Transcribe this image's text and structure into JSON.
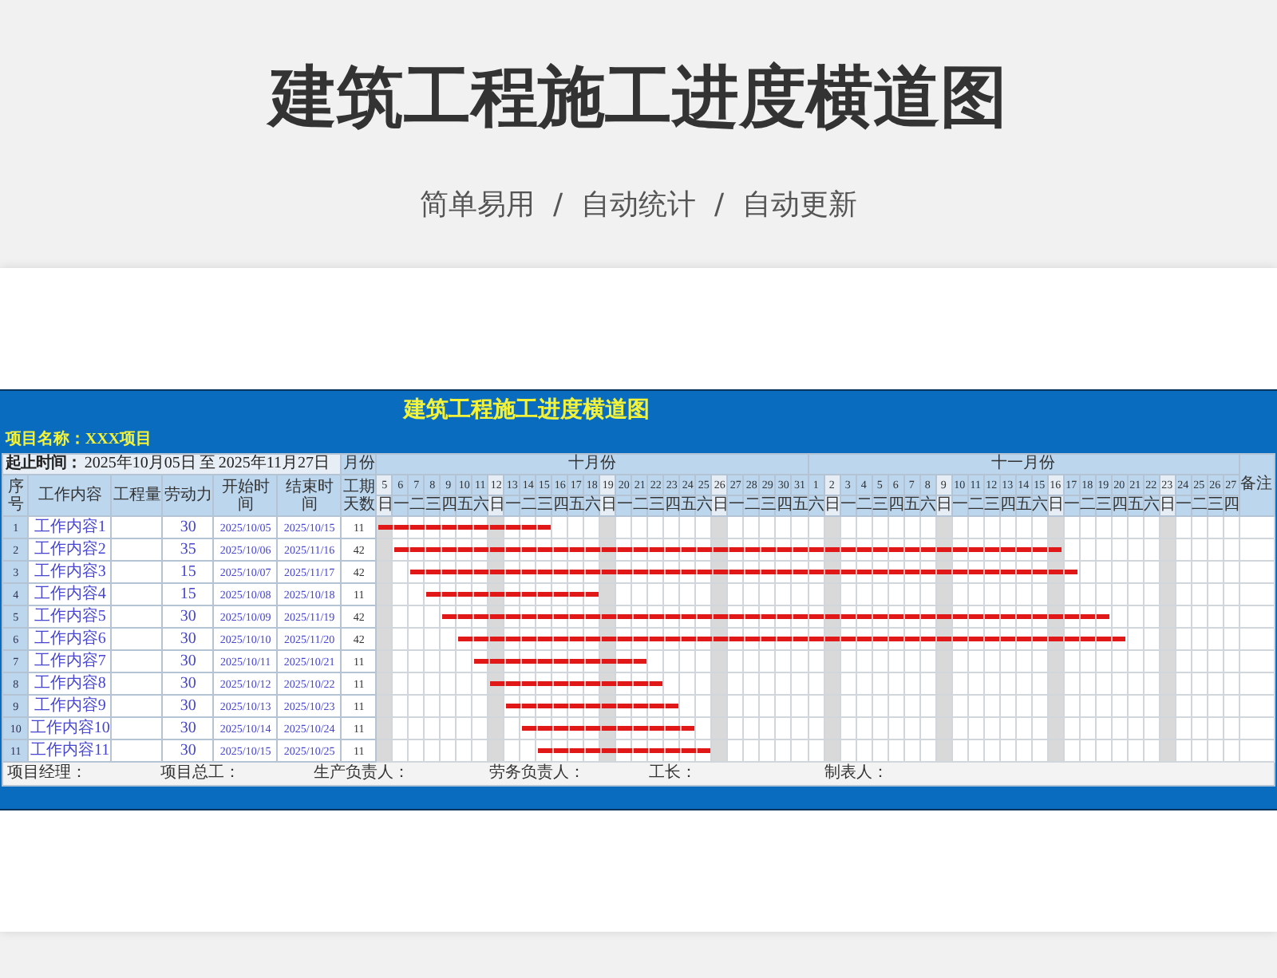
{
  "title": "建筑工程施工进度横道图",
  "subtitle": "简单易用  /  自动统计  /  自动更新",
  "sheet": {
    "title": "建筑工程施工进度横道图",
    "project": "项目名称：XXX项目",
    "date_range": {
      "label": "起止时间：",
      "start": "2025年10月05日",
      "to": "至",
      "end": "2025年11月27日"
    },
    "month_label": "月份",
    "remark_label": "备注",
    "columns": [
      "序号",
      "工作内容",
      "工程量",
      "劳动力",
      "开始时间",
      "结束时间",
      "工期天数"
    ],
    "months": [
      {
        "label": "十月份",
        "days": [
          {
            "day": "5",
            "weekday": "日",
            "weekend": true
          },
          {
            "day": "6",
            "weekday": "一",
            "weekend": false
          },
          {
            "day": "7",
            "weekday": "二",
            "weekend": false
          },
          {
            "day": "8",
            "weekday": "三",
            "weekend": false
          },
          {
            "day": "9",
            "weekday": "四",
            "weekend": false
          },
          {
            "day": "10",
            "weekday": "五",
            "weekend": false
          },
          {
            "day": "11",
            "weekday": "六",
            "weekend": false
          },
          {
            "day": "12",
            "weekday": "日",
            "weekend": true
          },
          {
            "day": "13",
            "weekday": "一",
            "weekend": false
          },
          {
            "day": "14",
            "weekday": "二",
            "weekend": false
          },
          {
            "day": "15",
            "weekday": "三",
            "weekend": false
          },
          {
            "day": "16",
            "weekday": "四",
            "weekend": false
          },
          {
            "day": "17",
            "weekday": "五",
            "weekend": false
          },
          {
            "day": "18",
            "weekday": "六",
            "weekend": false
          },
          {
            "day": "19",
            "weekday": "日",
            "weekend": true
          },
          {
            "day": "20",
            "weekday": "一",
            "weekend": false
          },
          {
            "day": "21",
            "weekday": "二",
            "weekend": false
          },
          {
            "day": "22",
            "weekday": "三",
            "weekend": false
          },
          {
            "day": "23",
            "weekday": "四",
            "weekend": false
          },
          {
            "day": "24",
            "weekday": "五",
            "weekend": false
          },
          {
            "day": "25",
            "weekday": "六",
            "weekend": false
          },
          {
            "day": "26",
            "weekday": "日",
            "weekend": true
          },
          {
            "day": "27",
            "weekday": "一",
            "weekend": false
          },
          {
            "day": "28",
            "weekday": "二",
            "weekend": false
          },
          {
            "day": "29",
            "weekday": "三",
            "weekend": false
          },
          {
            "day": "30",
            "weekday": "四",
            "weekend": false
          },
          {
            "day": "31",
            "weekday": "五",
            "weekend": false
          }
        ]
      },
      {
        "label": "十一月份",
        "days": [
          {
            "day": "1",
            "weekday": "六",
            "weekend": false
          },
          {
            "day": "2",
            "weekday": "日",
            "weekend": true
          },
          {
            "day": "3",
            "weekday": "一",
            "weekend": false
          },
          {
            "day": "4",
            "weekday": "二",
            "weekend": false
          },
          {
            "day": "5",
            "weekday": "三",
            "weekend": false
          },
          {
            "day": "6",
            "weekday": "四",
            "weekend": false
          },
          {
            "day": "7",
            "weekday": "五",
            "weekend": false
          },
          {
            "day": "8",
            "weekday": "六",
            "weekend": false
          },
          {
            "day": "9",
            "weekday": "日",
            "weekend": true
          },
          {
            "day": "10",
            "weekday": "一",
            "weekend": false
          },
          {
            "day": "11",
            "weekday": "二",
            "weekend": false
          },
          {
            "day": "12",
            "weekday": "三",
            "weekend": false
          },
          {
            "day": "13",
            "weekday": "四",
            "weekend": false
          },
          {
            "day": "14",
            "weekday": "五",
            "weekend": false
          },
          {
            "day": "15",
            "weekday": "六",
            "weekend": false
          },
          {
            "day": "16",
            "weekday": "日",
            "weekend": true
          },
          {
            "day": "17",
            "weekday": "一",
            "weekend": false
          },
          {
            "day": "18",
            "weekday": "二",
            "weekend": false
          },
          {
            "day": "19",
            "weekday": "三",
            "weekend": false
          },
          {
            "day": "20",
            "weekday": "四",
            "weekend": false
          },
          {
            "day": "21",
            "weekday": "五",
            "weekend": false
          },
          {
            "day": "22",
            "weekday": "六",
            "weekend": false
          },
          {
            "day": "23",
            "weekday": "日",
            "weekend": true
          },
          {
            "day": "24",
            "weekday": "一",
            "weekend": false
          },
          {
            "day": "25",
            "weekday": "二",
            "weekend": false
          },
          {
            "day": "26",
            "weekday": "三",
            "weekend": false
          },
          {
            "day": "27",
            "weekday": "四",
            "weekend": false
          }
        ]
      }
    ],
    "rows": [
      {
        "no": "1",
        "task": "工作内容1",
        "labor": "30",
        "start": "2025/10/05",
        "end": "2025/10/15",
        "duration": "11"
      },
      {
        "no": "2",
        "task": "工作内容2",
        "labor": "35",
        "start": "2025/10/06",
        "end": "2025/11/16",
        "duration": "42"
      },
      {
        "no": "3",
        "task": "工作内容3",
        "labor": "15",
        "start": "2025/10/07",
        "end": "2025/11/17",
        "duration": "42"
      },
      {
        "no": "4",
        "task": "工作内容4",
        "labor": "15",
        "start": "2025/10/08",
        "end": "2025/10/18",
        "duration": "11"
      },
      {
        "no": "5",
        "task": "工作内容5",
        "labor": "30",
        "start": "2025/10/09",
        "end": "2025/11/19",
        "duration": "42"
      },
      {
        "no": "6",
        "task": "工作内容6",
        "labor": "30",
        "start": "2025/10/10",
        "end": "2025/11/20",
        "duration": "42"
      },
      {
        "no": "7",
        "task": "工作内容7",
        "labor": "30",
        "start": "2025/10/11",
        "end": "2025/10/21",
        "duration": "11"
      },
      {
        "no": "8",
        "task": "工作内容8",
        "labor": "30",
        "start": "2025/10/12",
        "end": "2025/10/22",
        "duration": "11"
      },
      {
        "no": "9",
        "task": "工作内容9",
        "labor": "30",
        "start": "2025/10/13",
        "end": "2025/10/23",
        "duration": "11"
      },
      {
        "no": "10",
        "task": "工作内容10",
        "labor": "30",
        "start": "2025/10/14",
        "end": "2025/10/24",
        "duration": "11"
      },
      {
        "no": "11",
        "task": "工作内容11",
        "labor": "30",
        "start": "2025/10/15",
        "end": "2025/10/25",
        "duration": "11"
      }
    ],
    "signatures": [
      "项目经理：",
      "项目总工：",
      "生产负责人：",
      "劳务负责人：",
      "工长：",
      "制表人："
    ]
  }
}
